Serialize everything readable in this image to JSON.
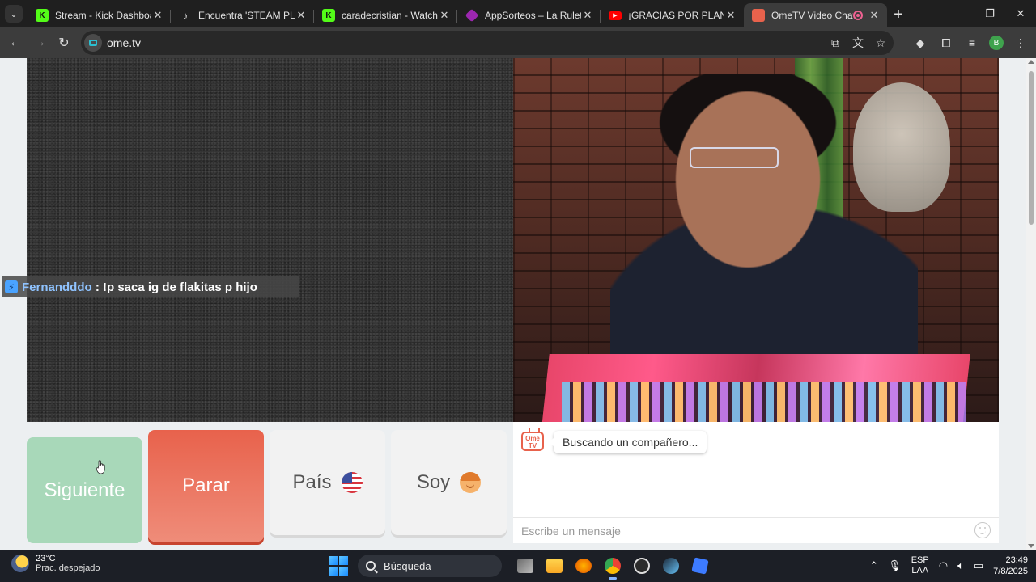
{
  "browser": {
    "tabs": [
      {
        "title": "Stream - Kick Dashboard",
        "icon": "kick-icon",
        "active": false
      },
      {
        "title": "Encuentra 'STEAM PLANTA",
        "icon": "tiktok-icon",
        "active": false
      },
      {
        "title": "caradecristian - Watch the",
        "icon": "kick-icon",
        "active": false
      },
      {
        "title": "AppSorteos – La Ruleta de",
        "icon": "appsorteos-icon",
        "active": false
      },
      {
        "title": "¡GRACIAS POR PLANTS VS",
        "icon": "youtube-icon",
        "active": false
      },
      {
        "title": "OmeTV Video Chat —",
        "icon": "ometv-icon",
        "active": true
      }
    ],
    "new_tab": "+",
    "window_controls": {
      "minimize": "—",
      "maximize": "❐",
      "close": "✕"
    },
    "url": "ome.tv",
    "profile_initial": "B"
  },
  "stranger_chat": {
    "username": "Fernandddo",
    "message": " : !p saca ig de flakitas p hijo"
  },
  "buttons": {
    "next": "Siguiente",
    "stop": "Parar",
    "country": "País",
    "gender": "Soy"
  },
  "chat": {
    "logo_text_1": "Ome",
    "logo_text_2": "TV",
    "status_message": "Buscando un compañero...",
    "input_placeholder": "Escribe un mensaje"
  },
  "taskbar": {
    "weather_temp": "23°C",
    "weather_desc": "Prac. despejado",
    "search_label": "Búsqueda",
    "lang_1": "ESP",
    "lang_2": "LAA",
    "time": "23:49",
    "date": "7/8/2025"
  },
  "colors": {
    "next_button": "#a8d8b9",
    "stop_button": "#e8624c",
    "accent": "#2bbfd0"
  }
}
